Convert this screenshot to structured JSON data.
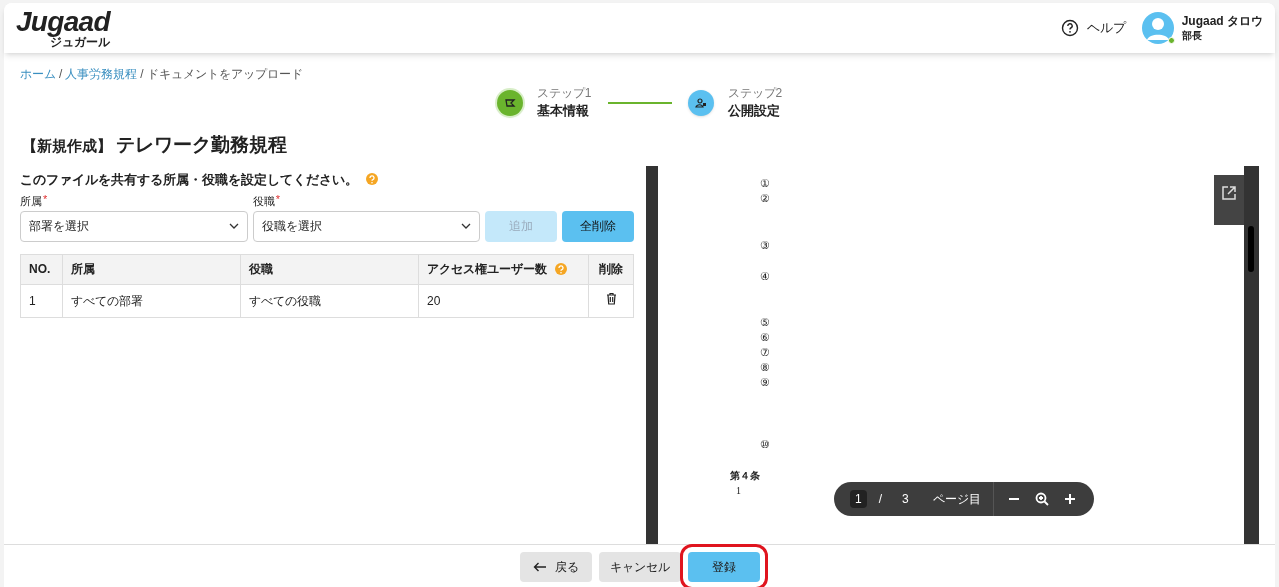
{
  "header": {
    "logo": "Jugaad",
    "logo_sub": "ジュガール",
    "help": "ヘルプ",
    "user": {
      "name": "Jugaad タロウ",
      "role": "部長",
      "online": true
    }
  },
  "breadcrumb": [
    {
      "label": "ホーム",
      "link": true
    },
    {
      "separator": "/",
      "label": "人事労務規程",
      "link": true
    },
    {
      "separator": "/",
      "label": "ドキュメントをアップロード",
      "link": false
    }
  ],
  "steps": [
    {
      "label": "ステップ1",
      "title": "基本情報",
      "kind": "done"
    },
    {
      "label": "ステップ2",
      "title": "公開設定",
      "kind": "current"
    }
  ],
  "title": {
    "tag": "【新規作成】",
    "name": "テレワーク勤務規程"
  },
  "form": {
    "heading": "このファイルを共有する所属・役職を設定してください。",
    "fields": [
      {
        "label": "所属",
        "required_mark": "*",
        "placeholder": "部署を選択"
      },
      {
        "label": "役職",
        "required_mark": "*",
        "placeholder": "役職を選択"
      }
    ],
    "buttons": [
      {
        "label": "追加",
        "disabled": true
      },
      {
        "label": "全削除",
        "disabled": false
      }
    ]
  },
  "table": {
    "columns": [
      {
        "label": "NO.",
        "help": false
      },
      {
        "label": "所属",
        "help": false
      },
      {
        "label": "役職",
        "help": false
      },
      {
        "label": "アクセス権ユーザー数",
        "help": true
      },
      {
        "label": "削除",
        "help": false
      }
    ],
    "rows": [
      {
        "cells": [
          "1",
          "すべての部署",
          "すべての役職",
          "20"
        ]
      }
    ]
  },
  "preview": {
    "lines": [
      {
        "kind": "item",
        "text": "①"
      },
      {
        "kind": "item",
        "text": "②"
      },
      {
        "kind": "item",
        "text": "③"
      },
      {
        "kind": "item",
        "text": "④"
      },
      {
        "kind": "item",
        "text": "⑤"
      },
      {
        "kind": "item",
        "text": "⑥"
      },
      {
        "kind": "item",
        "text": "⑦"
      },
      {
        "kind": "item",
        "text": "⑧"
      },
      {
        "kind": "item",
        "text": "⑨"
      },
      {
        "kind": "item",
        "text": "⑩"
      },
      {
        "kind": "heading",
        "text": "第４条"
      },
      {
        "kind": "para",
        "text": "1"
      }
    ],
    "toolbar": {
      "page": "1",
      "separator": "/",
      "total": "3",
      "suffix": "ページ目"
    }
  },
  "footer": {
    "buttons": [
      {
        "label": "戻る",
        "kind": "back",
        "highlighted": false
      },
      {
        "label": "キャンセル",
        "kind": "secondary",
        "highlighted": false
      },
      {
        "label": "登録",
        "kind": "primary",
        "highlighted": true
      }
    ]
  }
}
